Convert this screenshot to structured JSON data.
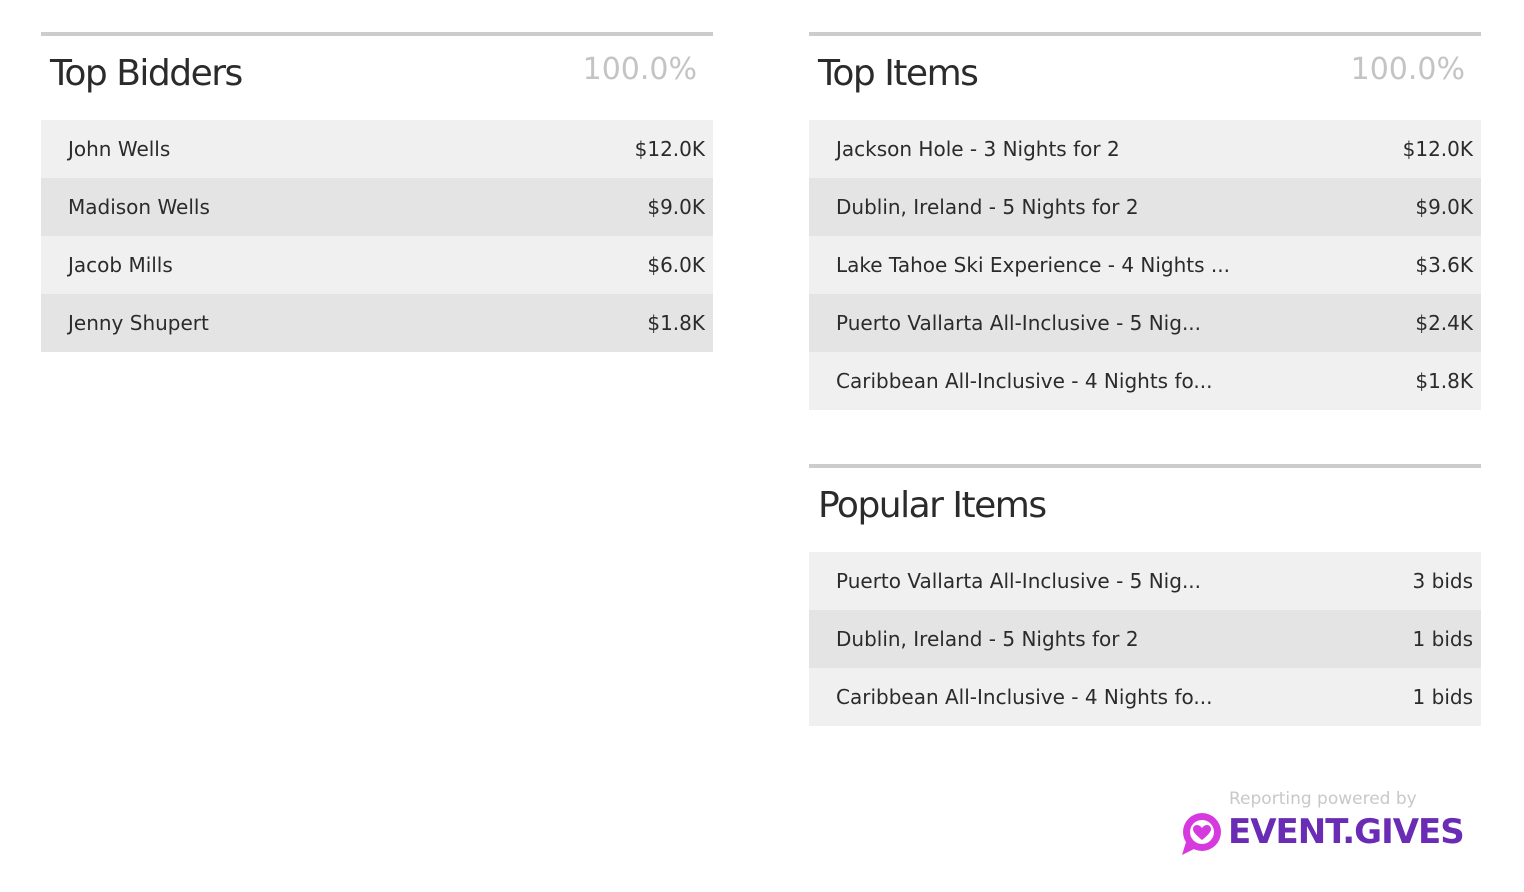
{
  "top_bidders": {
    "title": "Top Bidders",
    "percent": "100.0%",
    "rows": [
      {
        "label": "John Wells",
        "value": "$12.0K"
      },
      {
        "label": "Madison Wells",
        "value": "$9.0K"
      },
      {
        "label": "Jacob Mills",
        "value": "$6.0K"
      },
      {
        "label": "Jenny Shupert",
        "value": "$1.8K"
      }
    ]
  },
  "top_items": {
    "title": "Top Items",
    "percent": "100.0%",
    "rows": [
      {
        "label": "Jackson Hole - 3 Nights for 2",
        "value": "$12.0K"
      },
      {
        "label": "Dublin, Ireland - 5 Nights for 2",
        "value": "$9.0K"
      },
      {
        "label": "Lake Tahoe Ski Experience - 4 Nights ...",
        "value": "$3.6K"
      },
      {
        "label": "Puerto Vallarta All-Inclusive - 5 Nig...",
        "value": "$2.4K"
      },
      {
        "label": "Caribbean All-Inclusive - 4 Nights fo...",
        "value": "$1.8K"
      }
    ]
  },
  "popular_items": {
    "title": "Popular Items",
    "rows": [
      {
        "label": "Puerto Vallarta All-Inclusive - 5 Nig...",
        "value": "3 bids"
      },
      {
        "label": "Dublin, Ireland - 5 Nights for 2",
        "value": "1 bids"
      },
      {
        "label": "Caribbean All-Inclusive - 4 Nights fo...",
        "value": "1 bids"
      }
    ]
  },
  "branding": {
    "tagline": "Reporting powered by",
    "name": "EVENT.GIVES",
    "logo_icon": "heart-chat-bubble-icon",
    "colors": {
      "brand_purple": "#6a2bb5",
      "logo_pink": "#d63adf"
    }
  }
}
